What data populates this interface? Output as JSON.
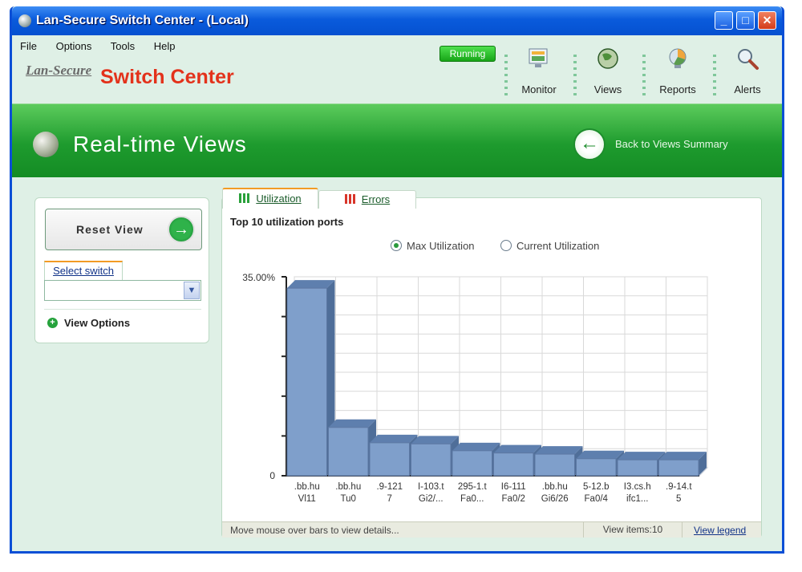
{
  "window": {
    "title": "Lan-Secure Switch Center - (Local)"
  },
  "menu": [
    "File",
    "Options",
    "Tools",
    "Help"
  ],
  "brand": {
    "part1": "Lan-Secure",
    "part2": "Switch Center"
  },
  "status_badge": "Running",
  "toolbar": [
    {
      "label": "Monitor",
      "icon": "monitor-icon"
    },
    {
      "label": "Views",
      "icon": "globe-icon"
    },
    {
      "label": "Reports",
      "icon": "reports-icon"
    },
    {
      "label": "Alerts",
      "icon": "magnifier-icon"
    }
  ],
  "banner": {
    "title": "Real-time Views",
    "back_label": "Back to Views Summary",
    "back_icon": "←"
  },
  "left_panel": {
    "reset_label": "Reset View",
    "reset_icon": "→",
    "select_tab": "Select switch",
    "select_arrow": "▼",
    "options_label": "View Options",
    "options_icon": "+"
  },
  "tabs": [
    {
      "label": "Utilization",
      "active": true
    },
    {
      "label": "Errors",
      "active": false
    }
  ],
  "chart_section": {
    "title": "Top 10 utilization ports",
    "radios": [
      {
        "label": "Max Utilization",
        "checked": true
      },
      {
        "label": "Current Utilization",
        "checked": false
      }
    ]
  },
  "chart_data": {
    "type": "bar",
    "categories": [
      [
        ".bb.hu",
        "Vl11"
      ],
      [
        ".bb.hu",
        "Tu0"
      ],
      [
        ".9-121",
        "7"
      ],
      [
        "I-103.t",
        "Gi2/..."
      ],
      [
        "295-1.t",
        "Fa0..."
      ],
      [
        "I6-111",
        "Fa0/2"
      ],
      [
        ".bb.hu",
        "Gi6/26"
      ],
      [
        "5-12.b",
        "Fa0/4"
      ],
      [
        "I3.cs.h",
        "ifc1..."
      ],
      [
        ".9-14.t",
        "5"
      ]
    ],
    "values": [
      33.0,
      8.5,
      5.8,
      5.6,
      4.4,
      4.0,
      3.8,
      3.0,
      2.8,
      2.8
    ],
    "y_ticks": [
      "35.00%",
      "0"
    ],
    "ylim": [
      0,
      35
    ],
    "grid": true,
    "bar_color": "#7f9fcb"
  },
  "footer": {
    "hint": "Move mouse over bars to view details...",
    "items": "View items:10",
    "legend_link": "View legend"
  }
}
